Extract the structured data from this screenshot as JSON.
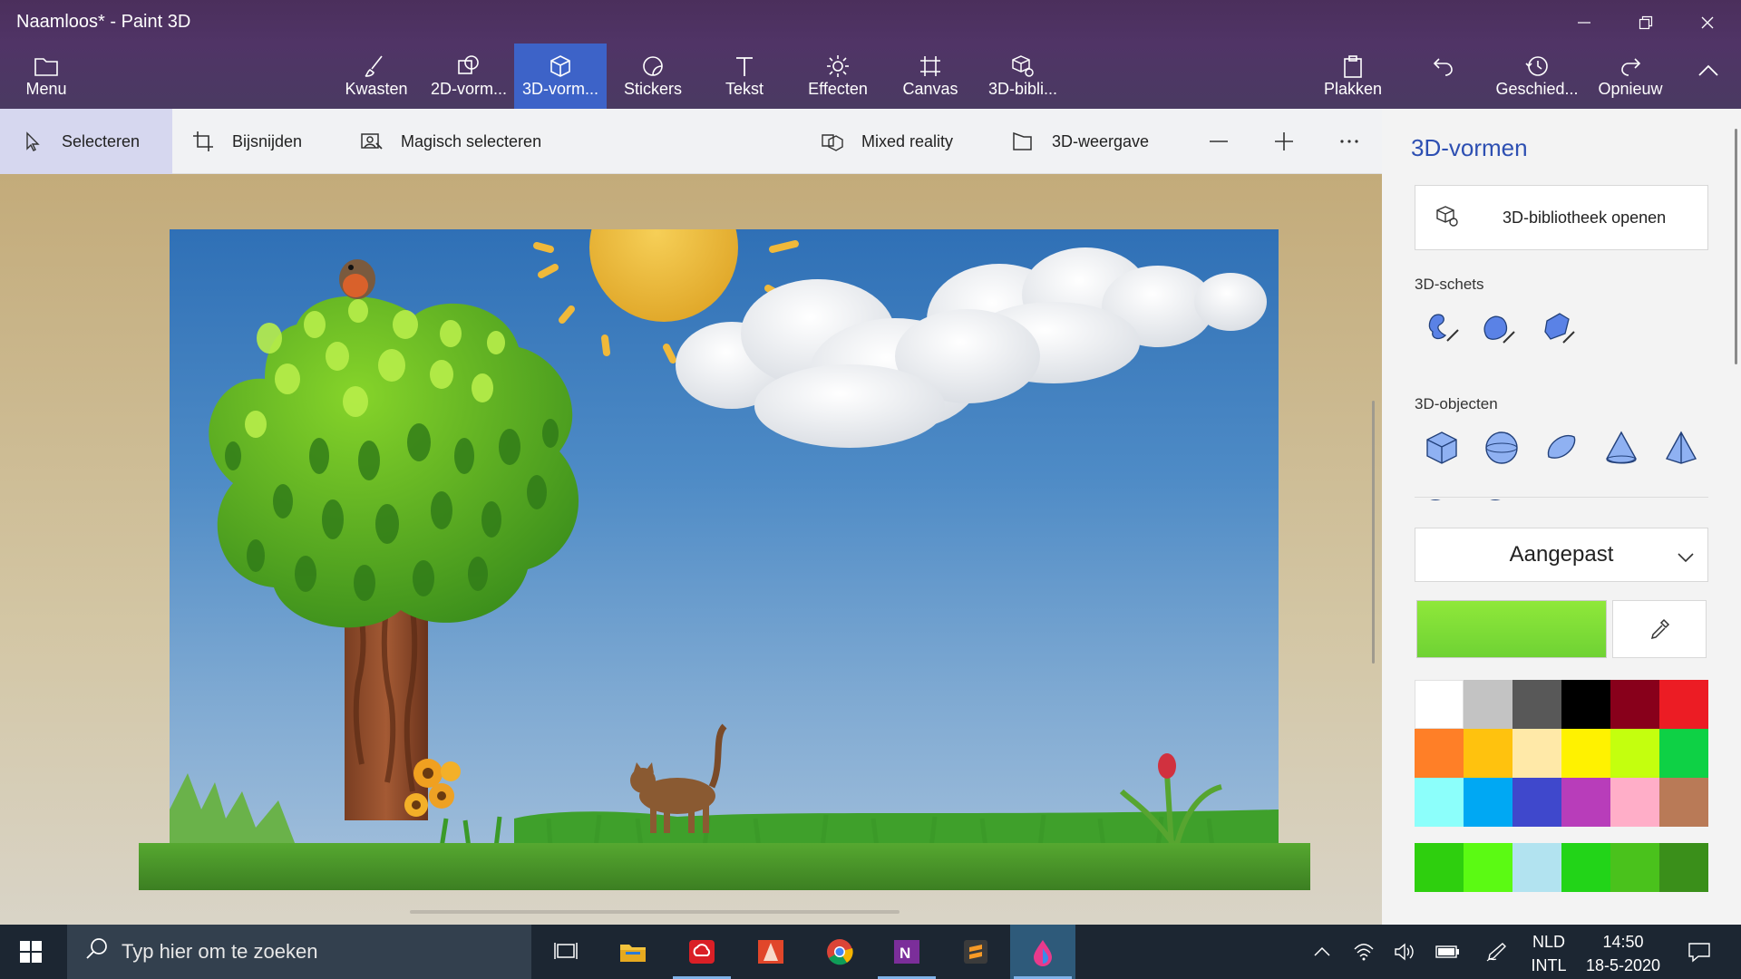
{
  "window": {
    "title": "Naamloos* - Paint 3D",
    "controls": [
      "minimize",
      "restore",
      "close"
    ]
  },
  "ribbon": {
    "menu_label": "Menu",
    "tools": [
      {
        "label": "Kwasten",
        "icon": "brush-icon"
      },
      {
        "label": "2D-vorm...",
        "icon": "2d-shapes-icon"
      },
      {
        "label": "3D-vorm...",
        "icon": "3d-shapes-icon",
        "active": true
      },
      {
        "label": "Stickers",
        "icon": "stickers-icon"
      },
      {
        "label": "Tekst",
        "icon": "text-icon"
      },
      {
        "label": "Effecten",
        "icon": "effects-icon"
      },
      {
        "label": "Canvas",
        "icon": "canvas-icon"
      },
      {
        "label": "3D-bibli...",
        "icon": "3d-library-icon"
      }
    ],
    "right": {
      "paste_label": "Plakken",
      "history_label": "Geschied...",
      "redo_label": "Opnieuw"
    }
  },
  "toolbar": {
    "select_label": "Selecteren",
    "crop_label": "Bijsnijden",
    "magic_select_label": "Magisch selecteren",
    "mixed_reality_label": "Mixed reality",
    "view3d_label": "3D-weergave"
  },
  "panel": {
    "title": "3D-vormen",
    "library_button": "3D-bibliotheek openen",
    "sketch_label": "3D-schets",
    "objects_label": "3D-objecten",
    "material_select": "Aangepast",
    "current_color": "#6fd234",
    "palette": [
      "#ffffff",
      "#c3c3c3",
      "#585858",
      "#000000",
      "#88001b",
      "#ec1c24",
      "#ff7f27",
      "#ffc20e",
      "#ffe9a8",
      "#fff200",
      "#c4ff0e",
      "#0ed145",
      "#8cfffb",
      "#00a8f3",
      "#3f48cc",
      "#b83dba",
      "#ffaec8",
      "#b97a57"
    ],
    "custom_palette": [
      "#2ecf0e",
      "#5bfa13",
      "#b2e3f0",
      "#22d418",
      "#4ac21c",
      "#3a8f1a"
    ]
  },
  "taskbar": {
    "search_placeholder": "Typ hier om te zoeken",
    "lang_top": "NLD",
    "lang_bottom": "INTL",
    "time": "14:50",
    "date": "18-5-2020"
  }
}
